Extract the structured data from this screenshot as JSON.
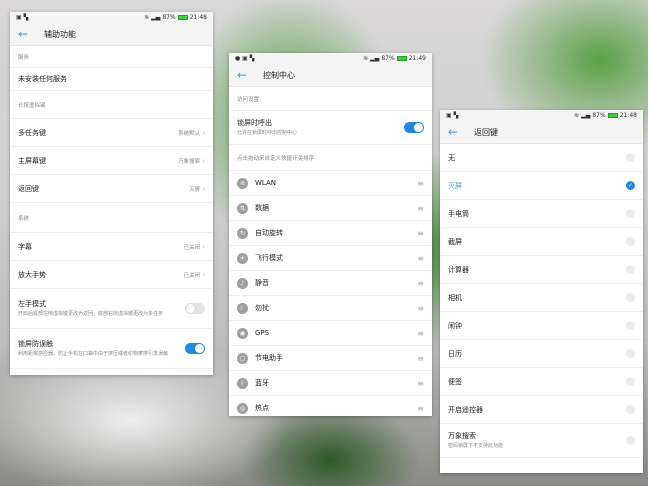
{
  "status": {
    "battery": "87%",
    "time1": "21:48",
    "time2": "21:49",
    "time3": "21:48"
  },
  "accessibility": {
    "title": "辅助功能",
    "sec_service": "服务",
    "no_service": "未安装任何服务",
    "sec_longpress": "长按虚拟键",
    "keys": [
      {
        "label": "多任务键",
        "value": "系统默认"
      },
      {
        "label": "主屏幕键",
        "value": "万象搜索"
      },
      {
        "label": "返回键",
        "value": "灭屏"
      }
    ],
    "sec_system": "系统",
    "system": [
      {
        "label": "字幕",
        "value": "已关闭"
      },
      {
        "label": "放大手势",
        "value": "已关闭"
      }
    ],
    "left_hand": {
      "label": "左手模式",
      "desc": "开启后底部左侧虚拟键更改为返回，底部右侧虚拟键更改为多任务",
      "on": false
    },
    "lock_guard": {
      "label": "锁屏防误触",
      "desc": "利用距离感应器，防止手机在口袋中由于挤压或者织物摩擦引发误触",
      "on": true
    }
  },
  "control": {
    "title": "控制中心",
    "sec_access": "访问设置",
    "lock_call": {
      "label": "锁屏时呼出",
      "desc": "允许在锁屏时呼出控制中心",
      "on": true
    },
    "sec_sort": "点击拖动来自定义快捷开关排序",
    "items": [
      {
        "label": "WLAN",
        "icon": "wifi"
      },
      {
        "label": "数据",
        "icon": "data"
      },
      {
        "label": "自动旋转",
        "icon": "rotate"
      },
      {
        "label": "飞行模式",
        "icon": "airplane"
      },
      {
        "label": "静音",
        "icon": "mute"
      },
      {
        "label": "勿扰",
        "icon": "moon"
      },
      {
        "label": "GPS",
        "icon": "location"
      },
      {
        "label": "节电助手",
        "icon": "battery-saver"
      },
      {
        "label": "蓝牙",
        "icon": "bluetooth"
      },
      {
        "label": "热点",
        "icon": "hotspot"
      }
    ]
  },
  "backkey": {
    "title": "返回键",
    "selected": 1,
    "options": [
      {
        "label": "无"
      },
      {
        "label": "灭屏"
      },
      {
        "label": "手电筒"
      },
      {
        "label": "截屏"
      },
      {
        "label": "计算器"
      },
      {
        "label": "相机"
      },
      {
        "label": "闹钟"
      },
      {
        "label": "日历"
      },
      {
        "label": "便签"
      },
      {
        "label": "开启遥控器"
      },
      {
        "label": "万象搜索",
        "desc": "密码锁屏下不支持此功能"
      }
    ]
  }
}
